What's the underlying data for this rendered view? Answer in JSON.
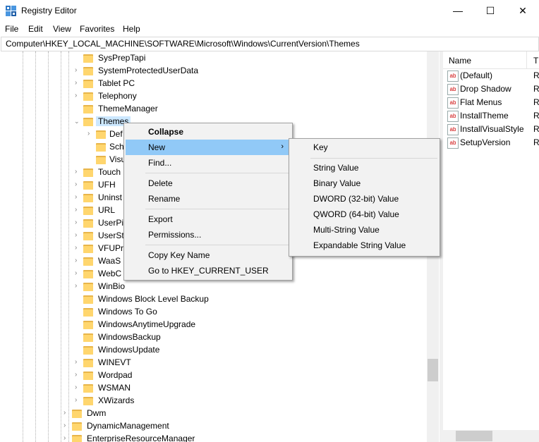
{
  "window": {
    "title": "Registry Editor"
  },
  "window_controls": {
    "minimize": "—",
    "maximize": "☐",
    "close": "✕"
  },
  "menubar": {
    "items": [
      "File",
      "Edit",
      "View",
      "Favorites",
      "Help"
    ]
  },
  "address": {
    "path": "Computer\\HKEY_LOCAL_MACHINE\\SOFTWARE\\Microsoft\\Windows\\CurrentVersion\\Themes"
  },
  "tree": {
    "items": [
      "SysPrepTapi",
      "SystemProtectedUserData",
      "Tablet PC",
      "Telephony",
      "ThemeManager",
      "Themes",
      "Def",
      "Sch",
      "Visu",
      "Touch",
      "UFH",
      "Uninst",
      "URL",
      "UserPi",
      "UserSt",
      "VFUPro",
      "WaaS",
      "WebC",
      "WinBio",
      "Windows Block Level Backup",
      "Windows To Go",
      "WindowsAnytimeUpgrade",
      "WindowsBackup",
      "WindowsUpdate",
      "WINEVT",
      "Wordpad",
      "WSMAN",
      "XWizards",
      "Dwm",
      "DynamicManagement",
      "EnterpriseResourceManager"
    ]
  },
  "values_pane": {
    "header_name": "Name",
    "header_type": "T",
    "rows": [
      {
        "name": "(Default)",
        "type": "R"
      },
      {
        "name": "Drop Shadow",
        "type": "R"
      },
      {
        "name": "Flat Menus",
        "type": "R"
      },
      {
        "name": "InstallTheme",
        "type": "R"
      },
      {
        "name": "InstallVisualStyle",
        "type": "R"
      },
      {
        "name": "SetupVersion",
        "type": "R"
      }
    ],
    "icon_text": "ab"
  },
  "context_menu": {
    "items": [
      "Collapse",
      "New",
      "Find...",
      "Delete",
      "Rename",
      "Export",
      "Permissions...",
      "Copy Key Name",
      "Go to HKEY_CURRENT_USER"
    ],
    "submenu_arrow": "›"
  },
  "new_submenu": {
    "items": [
      "Key",
      "String Value",
      "Binary Value",
      "DWORD (32-bit) Value",
      "QWORD (64-bit) Value",
      "Multi-String Value",
      "Expandable String Value"
    ]
  },
  "colors": {
    "highlight": "#91c9f7",
    "folder": "#ffd66e",
    "menu_bg": "#f2f2f2"
  }
}
